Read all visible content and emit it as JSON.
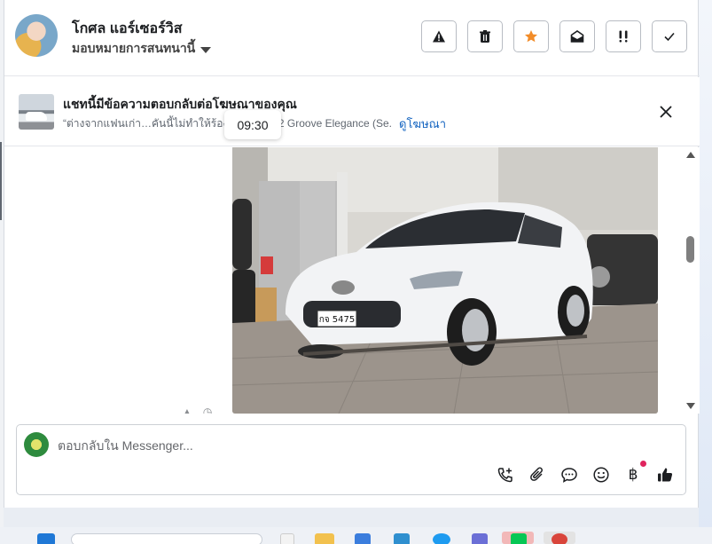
{
  "header": {
    "contact_name": "โกศล แอร์เซอร์วิส",
    "assign_label": "มอบหมายการสนทนานี้",
    "actions": [
      {
        "name": "spam-button",
        "icon": "warning-icon"
      },
      {
        "name": "delete-button",
        "icon": "trash-icon"
      },
      {
        "name": "star-button",
        "icon": "star-icon"
      },
      {
        "name": "mark-unread-button",
        "icon": "envelope-open-icon"
      },
      {
        "name": "follow-up-button",
        "icon": "double-exclamation-icon"
      },
      {
        "name": "mark-done-button",
        "icon": "check-icon"
      }
    ]
  },
  "ad_banner": {
    "title": "แชทนี้มีข้อความตอบกลับต่อโฆษณาของคุณ",
    "snippet": "“ต่างจากแฟนเก่า…คันนี้ไม่ทำให้ร้องไห้ Mazda 2 Groove Elegance (Se...",
    "link_label": "ดูโฆษณา",
    "tooltip_time": "09:30"
  },
  "message": {
    "plate_text": "กจ 5475"
  },
  "composer": {
    "placeholder": "ตอบกลับใน Messenger...",
    "baht_symbol": "฿"
  },
  "colors": {
    "accent_link": "#1464c0",
    "star": "#f28c28",
    "notification_dot": "#e0245e"
  }
}
